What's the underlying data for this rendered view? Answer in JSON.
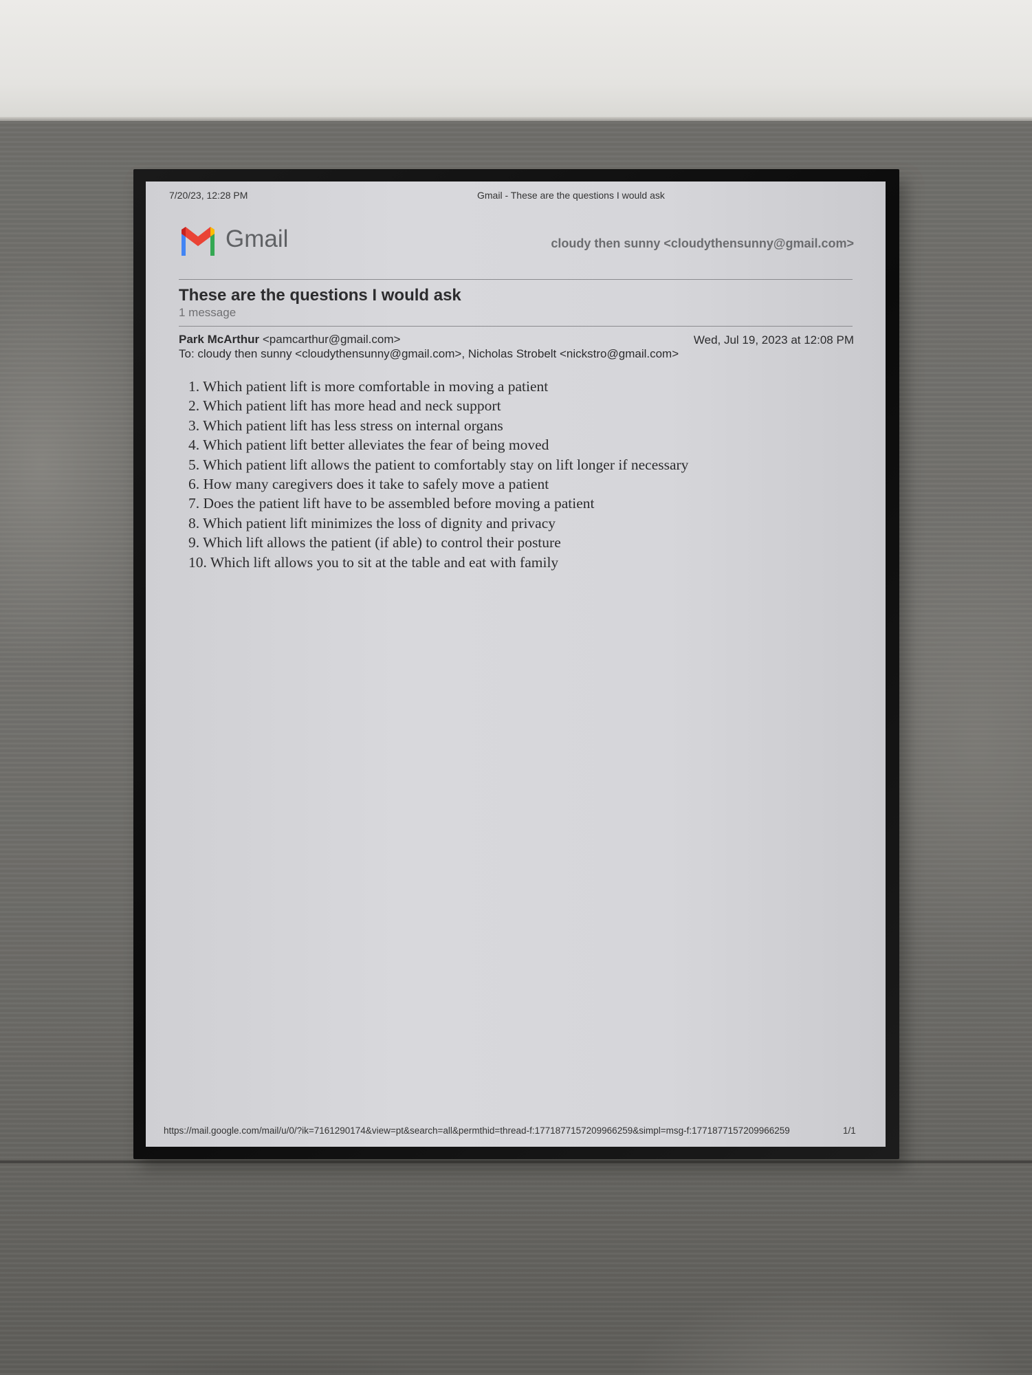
{
  "print_header": {
    "date": "7/20/23, 12:28 PM",
    "title": "Gmail - These are the questions I would ask"
  },
  "gmail": {
    "brand": "Gmail",
    "account": "cloudy then sunny <cloudythensunny@gmail.com>"
  },
  "thread": {
    "subject": "These are the questions I would ask",
    "count": "1 message"
  },
  "message": {
    "sender_name": "Park McArthur",
    "sender_email": "<pamcarthur@gmail.com>",
    "date": "Wed, Jul 19, 2023 at 12:08 PM",
    "to": "To: cloudy then sunny <cloudythensunny@gmail.com>, Nicholas Strobelt <nickstro@gmail.com>",
    "questions": [
      "1. Which patient lift is more comfortable in moving a patient",
      "2. Which patient lift has more head and neck support",
      "3. Which patient lift has less stress on internal organs",
      "4. Which patient lift better alleviates the fear of being moved",
      "5. Which patient lift allows the patient to comfortably stay on lift longer if necessary",
      "6. How many caregivers does it take to safely move a patient",
      "7. Does the patient lift have to be assembled before moving a patient",
      "8. Which patient lift minimizes the loss of dignity and privacy",
      "9. Which lift allows the patient (if able) to control their posture",
      "10. Which lift allows you to sit at the table and eat with family"
    ]
  },
  "print_footer": {
    "url": "https://mail.google.com/mail/u/0/?ik=7161290174&view=pt&search=all&permthid=thread-f:1771877157209966259&simpl=msg-f:1771877157209966259",
    "page": "1/1"
  },
  "colors": {
    "frame": "#111111",
    "paper": "#d6d6da",
    "concrete": "#6f6e6a",
    "wall": "#ecebe8",
    "gmail_red": "#ea4335",
    "gmail_blue": "#4285f4",
    "gmail_green": "#34a853",
    "gmail_yellow": "#fbbc04"
  },
  "icons": {
    "logo": "gmail-m-logo"
  }
}
